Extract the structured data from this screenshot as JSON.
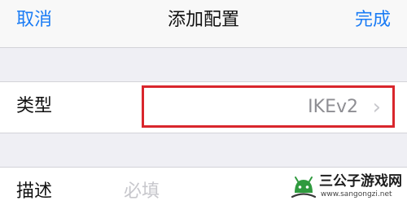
{
  "nav": {
    "cancel_label": "取消",
    "title": "添加配置",
    "done_label": "完成"
  },
  "type_row": {
    "label": "类型",
    "value": "IKEv2",
    "highlight_color": "#d9262c"
  },
  "description_row": {
    "label": "描述",
    "placeholder": "必填"
  },
  "watermark": {
    "title": "三公子游戏网",
    "url": "www.sangongzi.net"
  },
  "colors": {
    "accent": "#1b7cf5",
    "background": "#efeff4",
    "placeholder": "#c7c7cc"
  }
}
